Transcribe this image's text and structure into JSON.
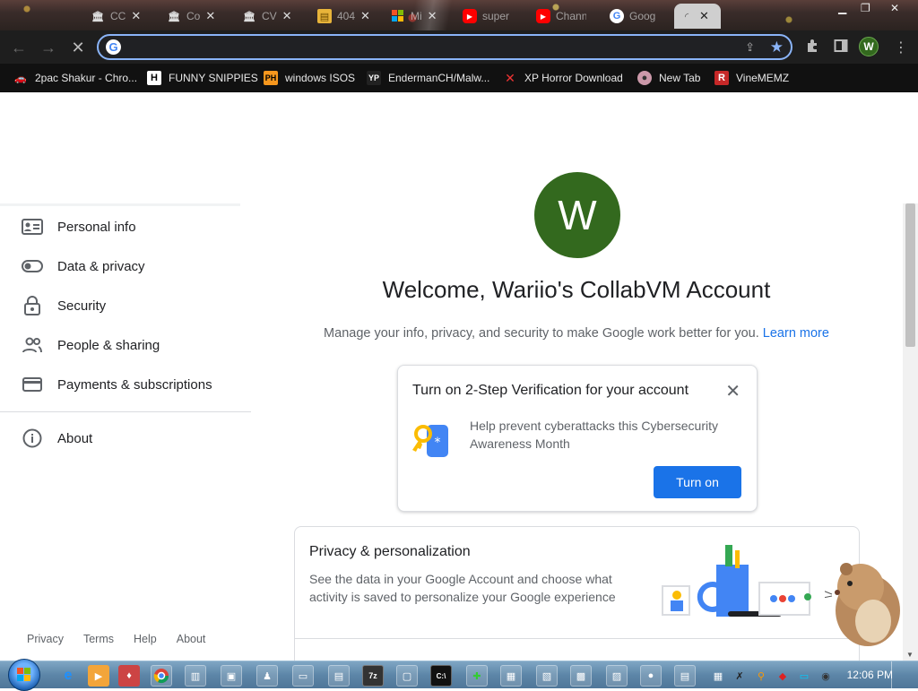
{
  "browser": {
    "tabs": [
      {
        "title": "CC",
        "icon": "building-icon"
      },
      {
        "title": "Co",
        "icon": "building-icon"
      },
      {
        "title": "CV",
        "icon": "building-icon"
      },
      {
        "title": "404",
        "icon": "folder-icon"
      },
      {
        "title": "Mi",
        "icon": "windows-logo-icon"
      },
      {
        "title": "super",
        "icon": "youtube-icon"
      },
      {
        "title": "Chann",
        "icon": "youtube-icon"
      },
      {
        "title": "Goog",
        "icon": "google-icon"
      },
      {
        "title": "",
        "icon": "loading-icon",
        "active": true
      }
    ],
    "address": {
      "value": "",
      "placeholder": ""
    },
    "profile_initial": "W",
    "bookmarks": [
      {
        "label": "2pac Shakur - Chro...",
        "icon": "car-icon"
      },
      {
        "label": "FUNNY SNIPPIES",
        "icon": "h-icon"
      },
      {
        "label": "windows ISOS",
        "icon": "ph-icon"
      },
      {
        "label": "EndermanCH/Malw...",
        "icon": "yp-icon"
      },
      {
        "label": "XP Horror Download",
        "icon": "x-icon"
      },
      {
        "label": "New Tab",
        "icon": "globe-icon"
      },
      {
        "label": "VineMEMZ",
        "icon": "r-icon"
      }
    ]
  },
  "account": {
    "avatar_initial": "W",
    "welcome": "Welcome, Wariio's CollabVM Account",
    "subtitle": "Manage your info, privacy, and security to make Google work better for you.",
    "learn_more": "Learn more",
    "nav": [
      {
        "label": "Personal info",
        "icon": "id-card-icon"
      },
      {
        "label": "Data & privacy",
        "icon": "toggle-icon"
      },
      {
        "label": "Security",
        "icon": "lock-icon"
      },
      {
        "label": "People & sharing",
        "icon": "people-icon"
      },
      {
        "label": "Payments & subscriptions",
        "icon": "credit-card-icon"
      },
      {
        "label": "About",
        "icon": "info-icon"
      }
    ],
    "footer": [
      "Privacy",
      "Terms",
      "Help",
      "About"
    ],
    "promo": {
      "title": "Turn on 2-Step Verification for your account",
      "description": "Help prevent cyberattacks this Cybersecurity Awareness Month",
      "button": "Turn on"
    },
    "privacy_card": {
      "title": "Privacy & personalization",
      "description": "See the data in your Google Account and choose what activity is saved to personalize your Google experience"
    }
  },
  "taskbar": {
    "clock": "12:06 PM"
  },
  "colors": {
    "accent": "#1a73e8",
    "avatar": "#33691e",
    "omnibox_border": "#8ab4f8"
  }
}
